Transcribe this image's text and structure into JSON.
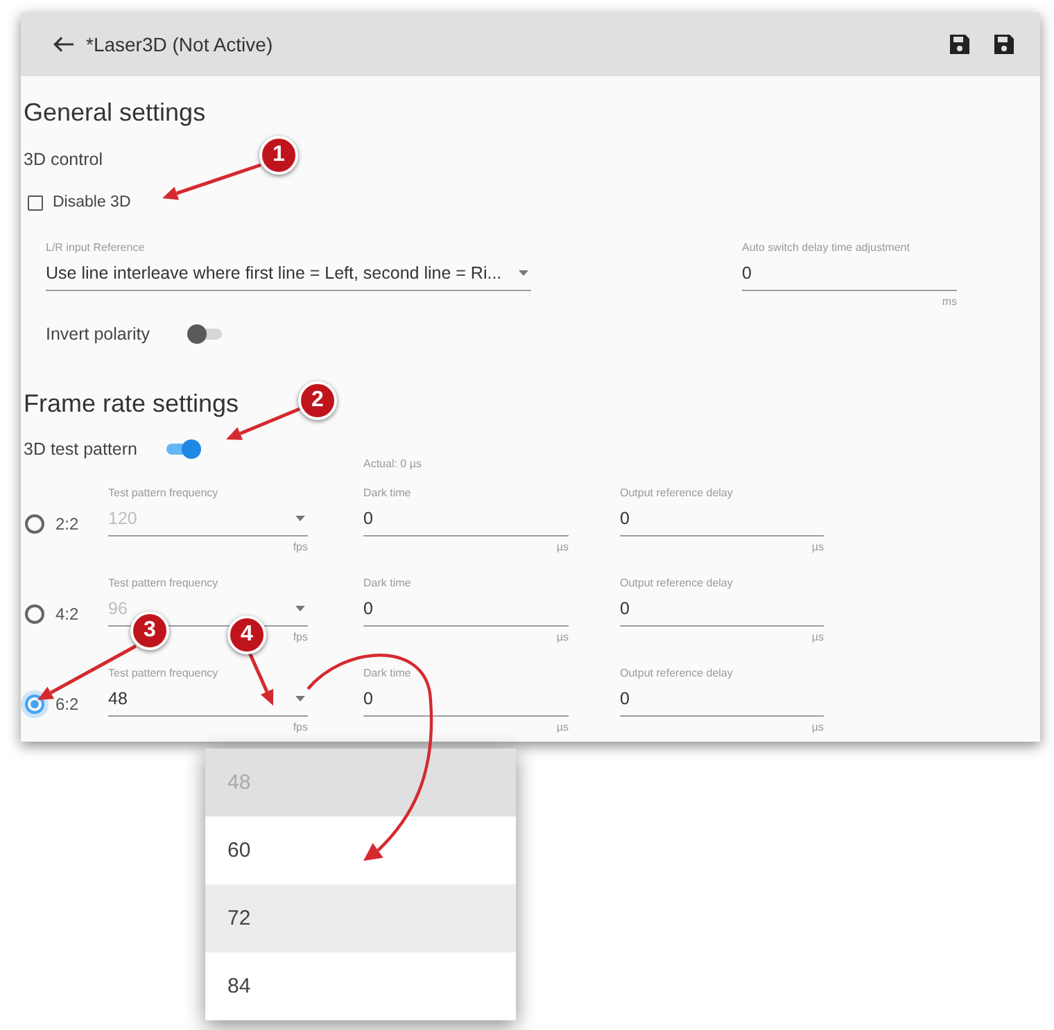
{
  "header": {
    "title": "*Laser3D (Not Active)"
  },
  "general_settings": {
    "title": "General settings",
    "section": "3D control",
    "disable_3d": {
      "label": "Disable 3D",
      "checked": false
    },
    "lr_input_reference": {
      "kind": "select",
      "label": "L/R input Reference",
      "value": "Use line interleave where first line = Left, second line = Ri..."
    },
    "auto_switch_delay": {
      "kind": "input",
      "label": "Auto switch delay time adjustment",
      "value": "0",
      "unit": "ms"
    },
    "invert_polarity": {
      "label": "Invert polarity",
      "on": false
    }
  },
  "frame_rate_settings": {
    "title": "Frame rate settings",
    "test_pattern": {
      "label": "3D test pattern",
      "on": true
    },
    "actual": "Actual: 0 µs",
    "modes": [
      {
        "label": "2:2",
        "selected": false,
        "fields": [
          {
            "kind": "select",
            "label": "Test pattern frequency",
            "value": "120",
            "unit": "fps",
            "disabled": true
          },
          {
            "kind": "input",
            "label": "Dark time",
            "value": "0",
            "unit": "µs"
          },
          {
            "kind": "input",
            "label": "Output reference delay",
            "value": "0",
            "unit": "µs"
          }
        ]
      },
      {
        "label": "4:2",
        "selected": false,
        "fields": [
          {
            "kind": "select",
            "label": "Test pattern frequency",
            "value": "96",
            "unit": "fps",
            "disabled": true
          },
          {
            "kind": "input",
            "label": "Dark time",
            "value": "0",
            "unit": "µs"
          },
          {
            "kind": "input",
            "label": "Output reference delay",
            "value": "0",
            "unit": "µs"
          }
        ]
      },
      {
        "label": "6:2",
        "selected": true,
        "fields": [
          {
            "kind": "select",
            "label": "Test pattern frequency",
            "value": "48",
            "unit": "fps",
            "disabled": false
          },
          {
            "kind": "input",
            "label": "Dark time",
            "value": "0",
            "unit": "µs"
          },
          {
            "kind": "input",
            "label": "Output reference delay",
            "value": "0",
            "unit": "µs"
          }
        ]
      }
    ]
  },
  "dropdown": {
    "options": [
      {
        "label": "48",
        "selected": true,
        "hovered": false
      },
      {
        "label": "60",
        "selected": false,
        "hovered": false
      },
      {
        "label": "72",
        "selected": false,
        "hovered": true
      },
      {
        "label": "84",
        "selected": false,
        "hovered": false
      }
    ]
  },
  "annotations": [
    {
      "number": "1"
    },
    {
      "number": "2"
    },
    {
      "number": "3"
    },
    {
      "number": "4"
    }
  ]
}
